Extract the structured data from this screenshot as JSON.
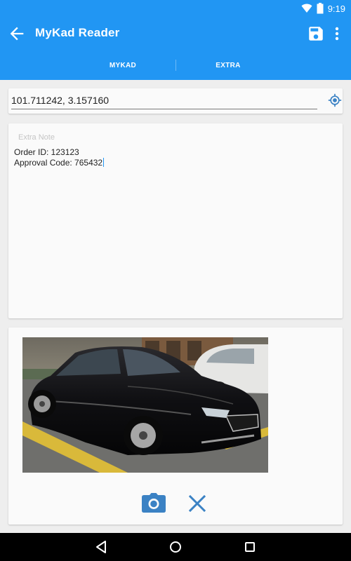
{
  "status_bar": {
    "time": "9:19"
  },
  "app_bar": {
    "title": "MyKad Reader"
  },
  "tabs": [
    {
      "label": "MYKAD"
    },
    {
      "label": "EXTRA"
    }
  ],
  "location": {
    "value": "101.711242, 3.157160"
  },
  "extra_note": {
    "label": "Extra Note",
    "lines": [
      "Order ID: 123123",
      "Approval Code: 765432"
    ]
  },
  "icons": {
    "back": "arrow-back-icon",
    "save": "save-icon",
    "more": "more-vert-icon",
    "location": "my-location-icon",
    "camera": "camera-icon",
    "close": "close-icon"
  },
  "colors": {
    "primary": "#2196f3",
    "icon_accent": "#3b82c4",
    "background": "#eeeeee",
    "card": "#fafafa"
  }
}
